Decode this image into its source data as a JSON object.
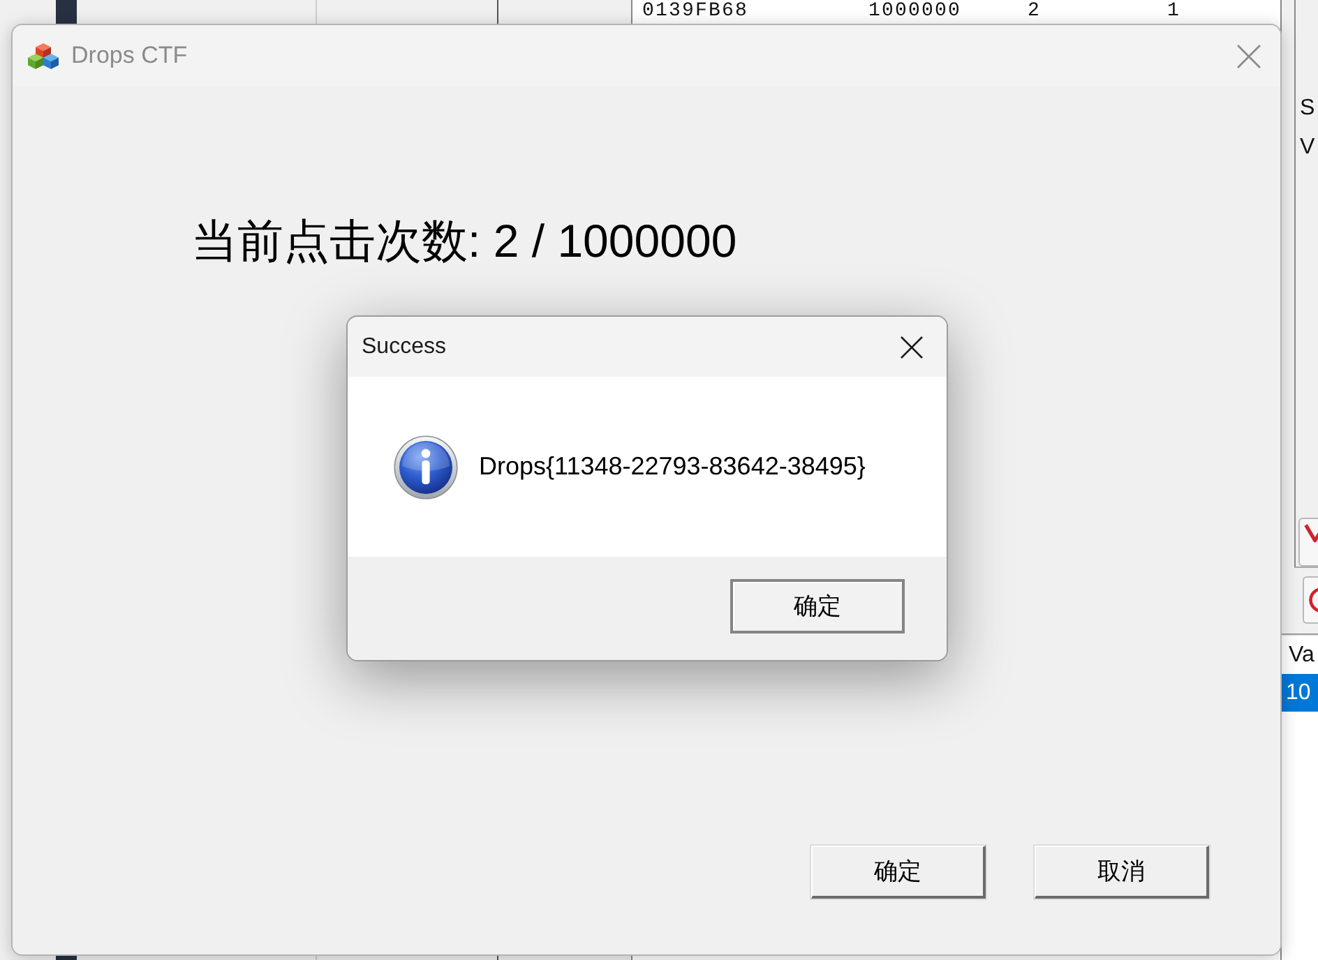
{
  "background_window": {
    "address_list": {
      "rows": [
        {
          "cells": [
            "0139FB68",
            "1000000",
            "2",
            "1"
          ]
        }
      ]
    },
    "side_panel": {
      "labels": [
        "S",
        "V"
      ]
    },
    "result_list": {
      "columns": [
        "Va"
      ],
      "rows": [
        {
          "cells": [
            "10"
          ],
          "selected": true
        }
      ]
    }
  },
  "main_window": {
    "title": "Drops CTF",
    "active": false,
    "counter_text": "当前点击次数: 2 / 1000000",
    "buttons": [
      {
        "label": "确定"
      },
      {
        "label": "取消"
      }
    ]
  },
  "message_box": {
    "title": "Success",
    "kind": "info",
    "message": "Drops{11348-22793-83642-38495}",
    "buttons": [
      {
        "label": "确定"
      }
    ]
  }
}
